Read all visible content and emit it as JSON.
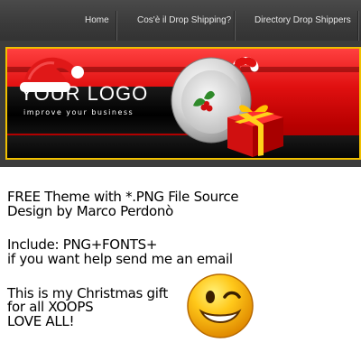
{
  "nav": {
    "items": [
      {
        "label": "Home"
      },
      {
        "label": "Cos'è il Drop Shipping?"
      },
      {
        "label": "Directory Drop Shippers"
      }
    ]
  },
  "banner": {
    "logo_title": "YOUR LOGO",
    "logo_tagline": "improve your business"
  },
  "content": {
    "lines": [
      "FREE Theme with *.PNG File Source",
      "Design by Marco Perdonò",
      "Include: PNG+FONTS+",
      "if you want help send me an email",
      "This is my Christmas gift",
      "for all XOOPS",
      "LOVE ALL!"
    ]
  },
  "colors": {
    "navbar": "#3a3a3a",
    "banner_red": "#d01010",
    "banner_border": "#f0c000",
    "text": "#000000"
  }
}
